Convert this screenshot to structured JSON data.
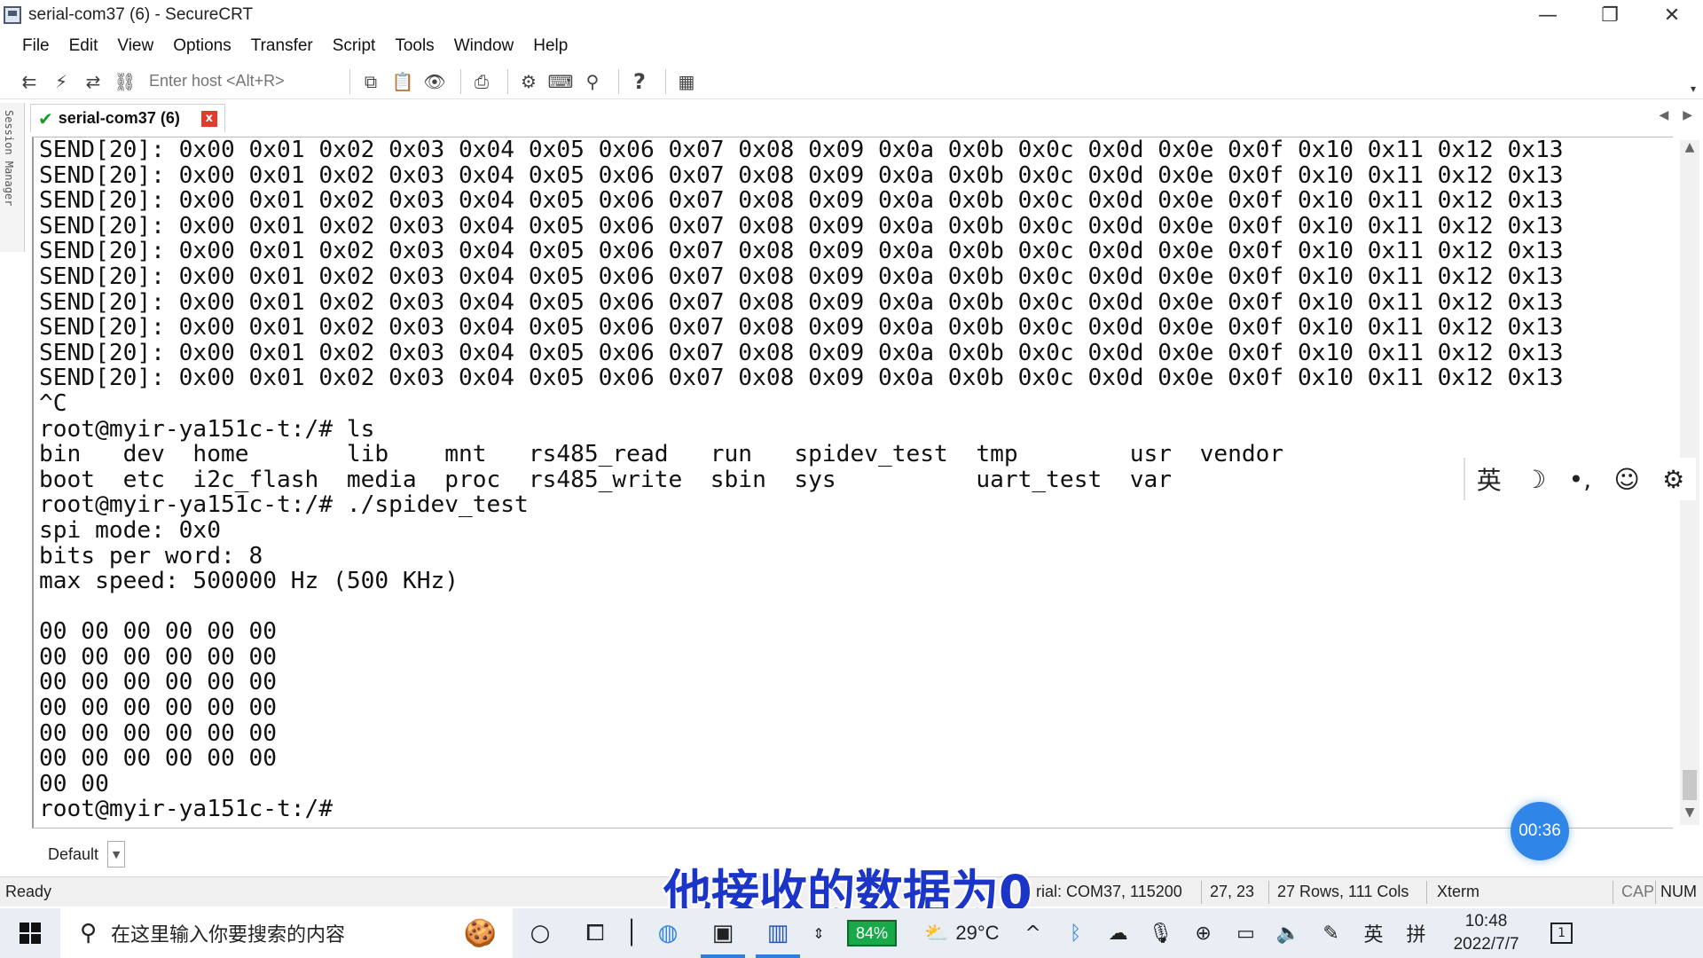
{
  "window": {
    "title": "serial-com37 (6) - SecureCRT",
    "minimize_glyph": "—",
    "restore_glyph": "❐",
    "close_glyph": "✕"
  },
  "menu": [
    "File",
    "Edit",
    "View",
    "Options",
    "Transfer",
    "Script",
    "Tools",
    "Window",
    "Help"
  ],
  "toolbar": {
    "host_placeholder": "Enter host <Alt+R>"
  },
  "session_manager_label": "Session Manager",
  "tab": {
    "label": "serial-com37 (6)",
    "close_glyph": "x"
  },
  "terminal_lines": [
    "SEND[20]: 0x00 0x01 0x02 0x03 0x04 0x05 0x06 0x07 0x08 0x09 0x0a 0x0b 0x0c 0x0d 0x0e 0x0f 0x10 0x11 0x12 0x13",
    "SEND[20]: 0x00 0x01 0x02 0x03 0x04 0x05 0x06 0x07 0x08 0x09 0x0a 0x0b 0x0c 0x0d 0x0e 0x0f 0x10 0x11 0x12 0x13",
    "SEND[20]: 0x00 0x01 0x02 0x03 0x04 0x05 0x06 0x07 0x08 0x09 0x0a 0x0b 0x0c 0x0d 0x0e 0x0f 0x10 0x11 0x12 0x13",
    "SEND[20]: 0x00 0x01 0x02 0x03 0x04 0x05 0x06 0x07 0x08 0x09 0x0a 0x0b 0x0c 0x0d 0x0e 0x0f 0x10 0x11 0x12 0x13",
    "SEND[20]: 0x00 0x01 0x02 0x03 0x04 0x05 0x06 0x07 0x08 0x09 0x0a 0x0b 0x0c 0x0d 0x0e 0x0f 0x10 0x11 0x12 0x13",
    "SEND[20]: 0x00 0x01 0x02 0x03 0x04 0x05 0x06 0x07 0x08 0x09 0x0a 0x0b 0x0c 0x0d 0x0e 0x0f 0x10 0x11 0x12 0x13",
    "SEND[20]: 0x00 0x01 0x02 0x03 0x04 0x05 0x06 0x07 0x08 0x09 0x0a 0x0b 0x0c 0x0d 0x0e 0x0f 0x10 0x11 0x12 0x13",
    "SEND[20]: 0x00 0x01 0x02 0x03 0x04 0x05 0x06 0x07 0x08 0x09 0x0a 0x0b 0x0c 0x0d 0x0e 0x0f 0x10 0x11 0x12 0x13",
    "SEND[20]: 0x00 0x01 0x02 0x03 0x04 0x05 0x06 0x07 0x08 0x09 0x0a 0x0b 0x0c 0x0d 0x0e 0x0f 0x10 0x11 0x12 0x13",
    "SEND[20]: 0x00 0x01 0x02 0x03 0x04 0x05 0x06 0x07 0x08 0x09 0x0a 0x0b 0x0c 0x0d 0x0e 0x0f 0x10 0x11 0x12 0x13",
    "^C",
    "root@myir-ya151c-t:/# ls",
    "bin   dev  home       lib    mnt   rs485_read   run   spidev_test  tmp        usr  vendor",
    "boot  etc  i2c_flash  media  proc  rs485_write  sbin  sys          uart_test  var",
    "root@myir-ya151c-t:/# ./spidev_test",
    "spi mode: 0x0",
    "bits per word: 8",
    "max speed: 500000 Hz (500 KHz)",
    "",
    "00 00 00 00 00 00",
    "00 00 00 00 00 00",
    "00 00 00 00 00 00",
    "00 00 00 00 00 00",
    "00 00 00 00 00 00",
    "00 00 00 00 00 00",
    "00 00",
    "root@myir-ya151c-t:/#"
  ],
  "ime_bar": {
    "lang": "英",
    "moon": "☽",
    "punct": "•,",
    "emoji": "☺",
    "settings": "⚙"
  },
  "button_bar": {
    "selected": "Default"
  },
  "timer": "00:36",
  "subtitle": "他接收的数据为0",
  "status": {
    "ready": "Ready",
    "connection": "rial: COM37, 115200",
    "cursor": "27,  23",
    "size": "27 Rows, 111 Cols",
    "emulation": "Xterm",
    "cap": "CAP",
    "num": "NUM"
  },
  "taskbar": {
    "search_placeholder": "在这里输入你要搜索的内容",
    "battery": "84%",
    "temperature": "29°C",
    "ime_lang": "英",
    "ime_layout": "拼",
    "time": "10:48",
    "date": "2022/7/7",
    "notification_count": "1"
  }
}
